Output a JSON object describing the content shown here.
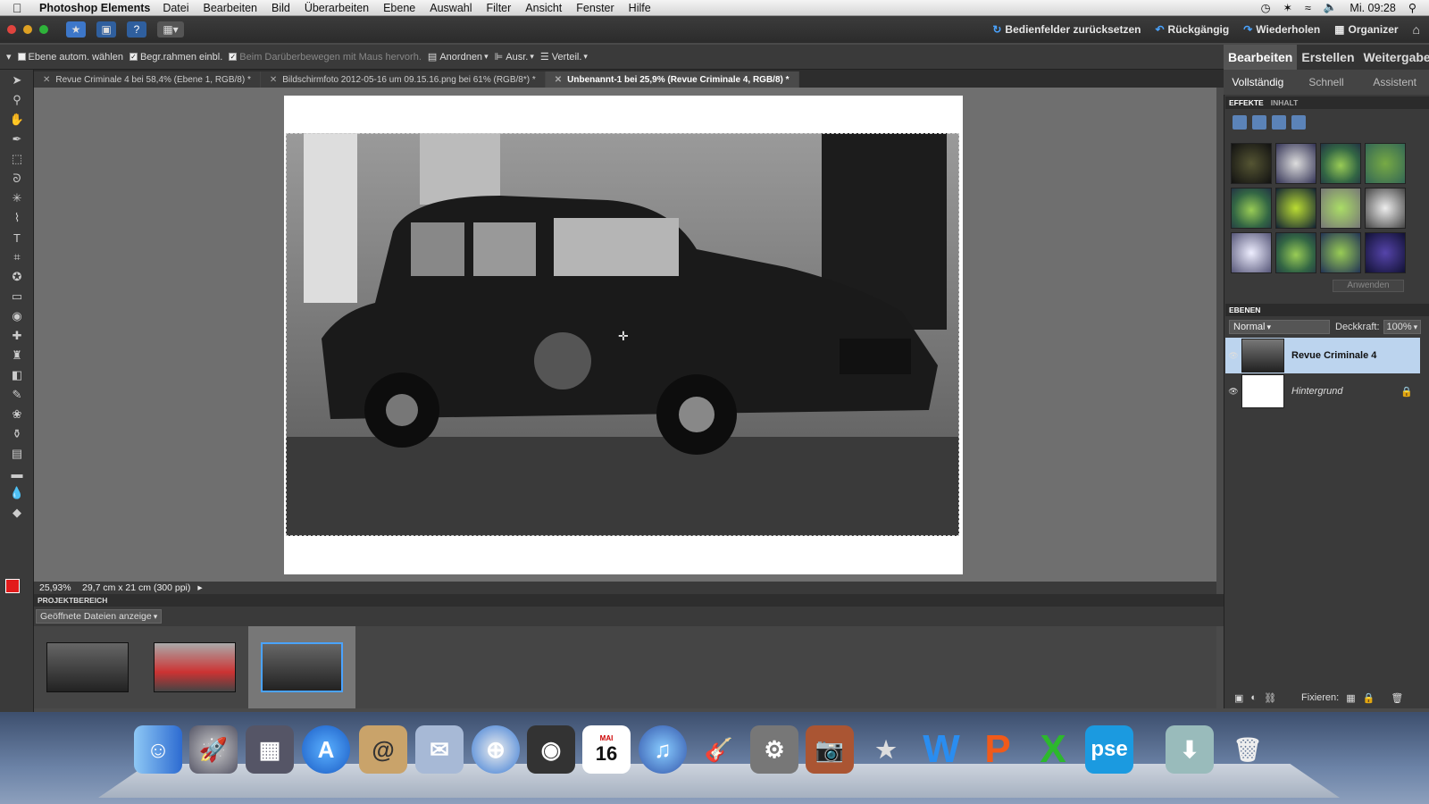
{
  "menubar": {
    "app_name": "Photoshop Elements",
    "items": [
      "Datei",
      "Bearbeiten",
      "Bild",
      "Überarbeiten",
      "Ebene",
      "Auswahl",
      "Filter",
      "Ansicht",
      "Fenster",
      "Hilfe"
    ],
    "clock": "Mi. 09:28"
  },
  "apptop": {
    "reset_panels": "Bedienfelder zurücksetzen",
    "undo": "Rückgängig",
    "redo": "Wiederholen",
    "organizer": "Organizer"
  },
  "options": {
    "auto_select": "Ebene autom. wählen",
    "bounding_box": "Begr.rahmen einbl.",
    "hover_highlight": "Beim Darüberbewegen mit Maus hervorh.",
    "arrange": "Anordnen",
    "align": "Ausr.",
    "distribute": "Verteil."
  },
  "tabs": [
    {
      "label": "Revue Criminale 4 bei 58,4% (Ebene 1, RGB/8) *"
    },
    {
      "label": "Bildschirmfoto 2012-05-16 um 09.15.16.png bei 61% (RGB/8*) *"
    },
    {
      "label": "Unbenannt-1 bei 25,9% (Revue Criminale 4, RGB/8) *"
    }
  ],
  "status": {
    "zoom": "25,93%",
    "doc_size": "29,7 cm x 21 cm (300 ppi)"
  },
  "project": {
    "header": "PROJEKTBEREICH",
    "selector": "Geöffnete Dateien anzeige"
  },
  "modes": {
    "edit": "Bearbeiten",
    "create": "Erstellen",
    "share": "Weitergabe"
  },
  "submodes": {
    "full": "Vollständig",
    "quick": "Schnell",
    "guided": "Assistent"
  },
  "effects": {
    "tab_effects": "EFFEKTE",
    "tab_content": "INHALT",
    "apply": "Anwenden"
  },
  "layers": {
    "header": "EBENEN",
    "blend_mode": "Normal",
    "opacity_label": "Deckkraft:",
    "opacity_value": "100%",
    "items": [
      {
        "name": "Revue Criminale 4"
      },
      {
        "name": "Hintergrund"
      }
    ],
    "lock_label": "Fixieren:"
  },
  "dock": {
    "calendar_month": "MAI",
    "calendar_day": "16",
    "pse_label": "pse"
  }
}
